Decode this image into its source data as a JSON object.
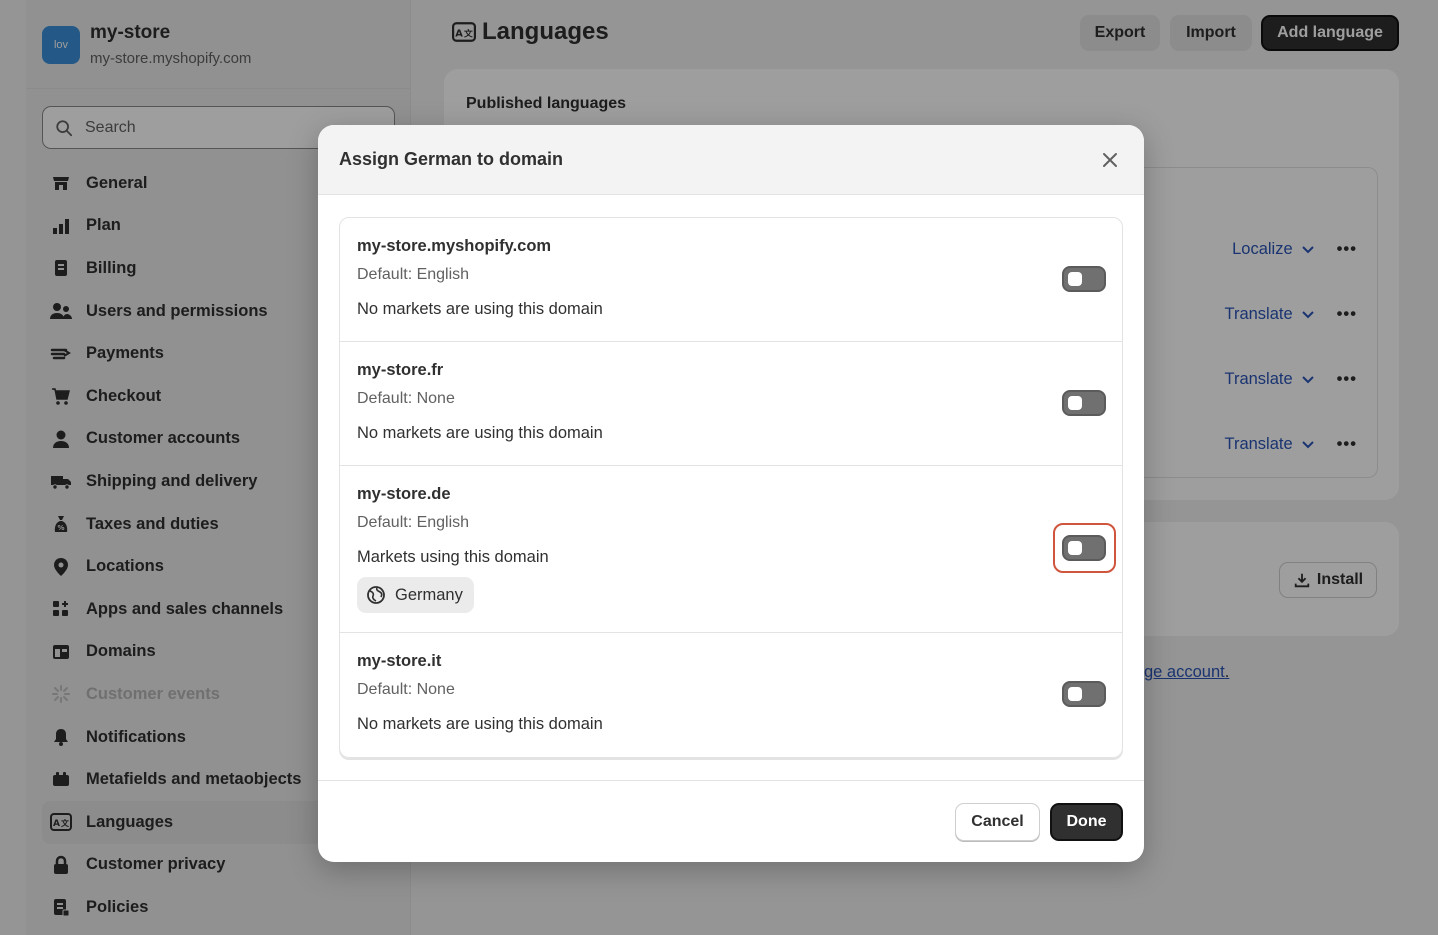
{
  "store": {
    "avatar_text": "lov",
    "name": "my-store",
    "url": "my-store.myshopify.com"
  },
  "search": {
    "placeholder": "Search"
  },
  "sidebar": {
    "items": [
      {
        "label": "General",
        "icon": "store-icon"
      },
      {
        "label": "Plan",
        "icon": "plan-chart-icon"
      },
      {
        "label": "Billing",
        "icon": "receipt-icon"
      },
      {
        "label": "Users and permissions",
        "icon": "users-icon"
      },
      {
        "label": "Payments",
        "icon": "payment-hand-icon"
      },
      {
        "label": "Checkout",
        "icon": "cart-icon"
      },
      {
        "label": "Customer accounts",
        "icon": "person-icon"
      },
      {
        "label": "Shipping and delivery",
        "icon": "truck-icon"
      },
      {
        "label": "Taxes and duties",
        "icon": "tax-bag-icon"
      },
      {
        "label": "Locations",
        "icon": "location-pin-icon"
      },
      {
        "label": "Apps and sales channels",
        "icon": "apps-icon"
      },
      {
        "label": "Domains",
        "icon": "domains-icon"
      },
      {
        "label": "Customer events",
        "icon": "sparkle-icon"
      },
      {
        "label": "Notifications",
        "icon": "bell-icon"
      },
      {
        "label": "Metafields and metaobjects",
        "icon": "metafields-icon"
      },
      {
        "label": "Languages",
        "icon": "language-icon"
      },
      {
        "label": "Customer privacy",
        "icon": "lock-icon"
      },
      {
        "label": "Policies",
        "icon": "policies-icon"
      }
    ]
  },
  "page": {
    "title": "Languages",
    "export_label": "Export",
    "import_label": "Import",
    "add_language_label": "Add language",
    "published_heading": "Published languages",
    "rows": [
      {
        "action": "Localize",
        "more": "•••"
      },
      {
        "action": "Translate",
        "more": "•••"
      },
      {
        "action": "Translate",
        "more": "•••"
      },
      {
        "action": "Translate",
        "more": "•••"
      }
    ],
    "install_label": "Install",
    "manage_account_link": "ge account",
    "manage_account_suffix": "."
  },
  "modal": {
    "title": "Assign German to domain",
    "domains": [
      {
        "name": "my-store.myshopify.com",
        "default": "Default: English",
        "markets_text": "No markets are using this domain",
        "markets": [],
        "enabled": false
      },
      {
        "name": "my-store.fr",
        "default": "Default: None",
        "markets_text": "No markets are using this domain",
        "markets": [],
        "enabled": false
      },
      {
        "name": "my-store.de",
        "default": "Default: English",
        "markets_text": "Markets using this domain",
        "markets": [
          "Germany"
        ],
        "enabled": false,
        "focused": true
      },
      {
        "name": "my-store.it",
        "default": "Default: None",
        "markets_text": "No markets are using this domain",
        "markets": [],
        "enabled": false
      }
    ],
    "cancel_label": "Cancel",
    "done_label": "Done"
  },
  "colors": {
    "primary_button": "#303030",
    "link": "#2a55b6",
    "focus_ring": "#d0553d",
    "toggle_off": "#707070"
  }
}
